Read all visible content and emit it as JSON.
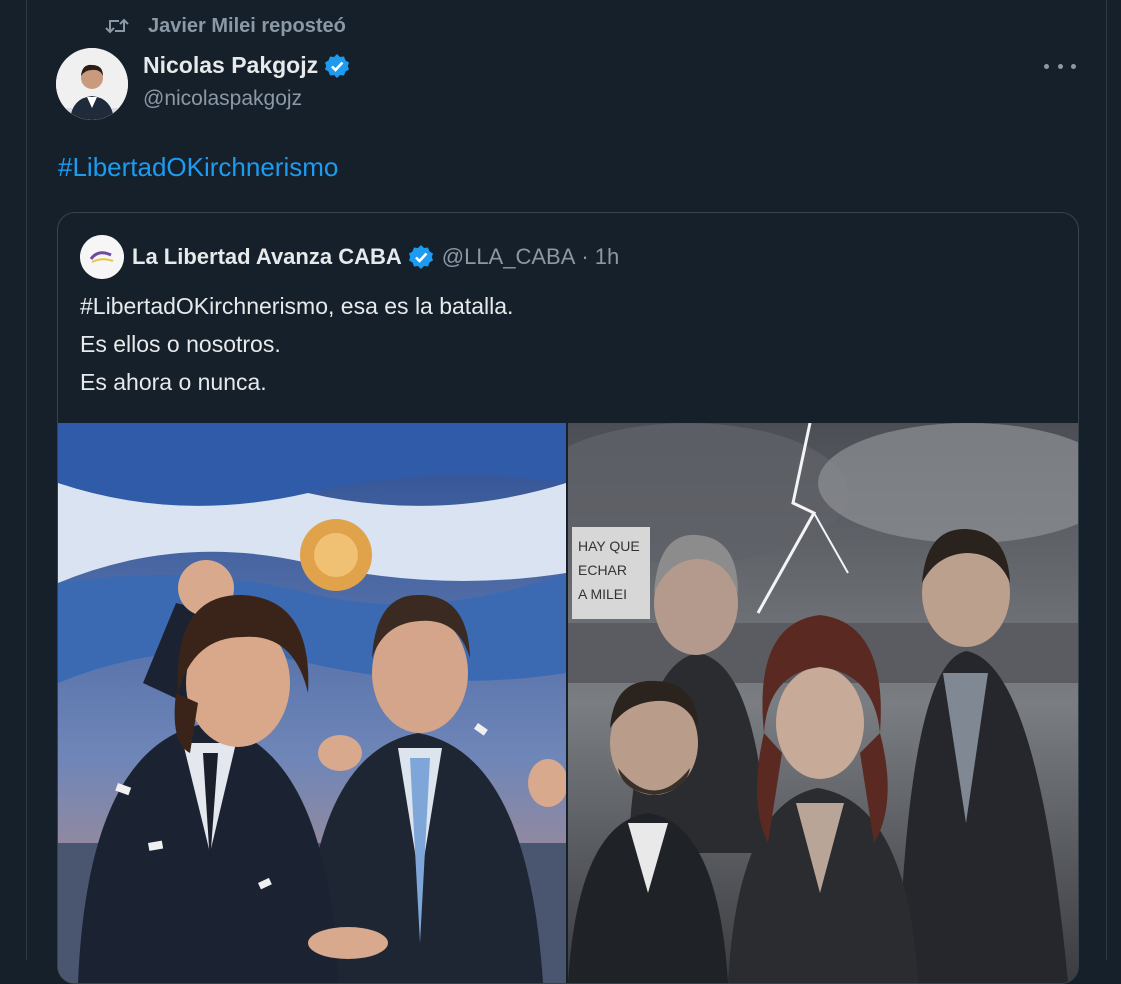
{
  "repost": {
    "text": "Javier Milei reposteó",
    "icon": "retweet-icon"
  },
  "post": {
    "author_name": "Nicolas Pakgojz",
    "author_handle": "@nicolaspakgojz",
    "verified": true,
    "hashtag": "#LibertadOKirchnerismo"
  },
  "quote": {
    "author_name": "La Libertad Avanza CABA",
    "handle": "@LLA_CABA",
    "separator": "·",
    "time": "1h",
    "lines": [
      "#LibertadOKirchnerismo, esa es la batalla.",
      "Es ellos o nosotros.",
      "Es ahora o nunca."
    ],
    "media_left_caption": "",
    "media_right_sign": [
      "HAY QUE",
      "ECHAR",
      "A MILEI"
    ]
  },
  "colors": {
    "background": "#15202b",
    "accent": "#1d9bf0",
    "secondary_text": "#8b98a5",
    "primary_text": "#e7e9ea",
    "border": "#38444d"
  }
}
